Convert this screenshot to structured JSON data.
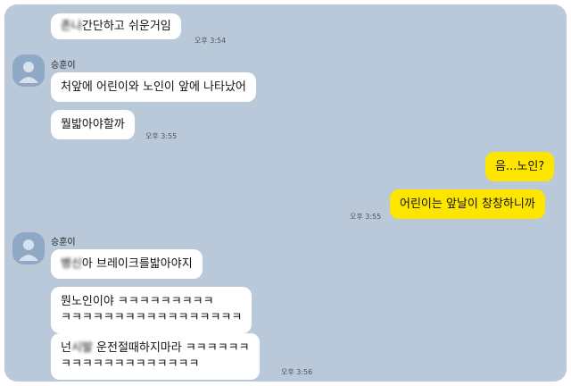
{
  "chat": {
    "background": "#b9c9d9",
    "bubble_other_color": "#ffffff",
    "bubble_me_color": "#fee500",
    "avatar_icon": "profile-avatar-icon",
    "messages": [
      {
        "sender": "other",
        "censored": "존나",
        "text": "간단하고 쉬운거임",
        "time": "오후 3:54"
      },
      {
        "sender": "other",
        "name": "승훈이",
        "text": "처앞에 어린이와 노인이 앞에 나타났어"
      },
      {
        "sender": "other",
        "text": "뭘밟아야할까",
        "time": "오후 3:55"
      },
      {
        "sender": "me",
        "text": "음...노인?"
      },
      {
        "sender": "me",
        "text": "어린이는 앞날이 창창하니까",
        "time": "오후 3:55"
      },
      {
        "sender": "other",
        "name": "승훈이",
        "censored": "병신",
        "text": "아 브레이크를밟아야지"
      },
      {
        "sender": "other",
        "line1": "뭔노인이야 ㅋㅋㅋㅋㅋㅋㅋㅋㅋ",
        "line2": "ㅋㅋㅋㅋㅋㅋㅋㅋㅋㅋㅋㅋㅋㅋㅋㅋㅋ"
      },
      {
        "sender": "other",
        "line1_prefix": "넌",
        "censored": "시발",
        "line1": "운전절때하지마라 ㅋㅋㅋㅋㅋㅋ",
        "line2": "ㅋㅋㅋㅋㅋㅋㅋㅋㅋㅋㅋㅋㅋ",
        "time": "오후 3:56"
      }
    ]
  }
}
